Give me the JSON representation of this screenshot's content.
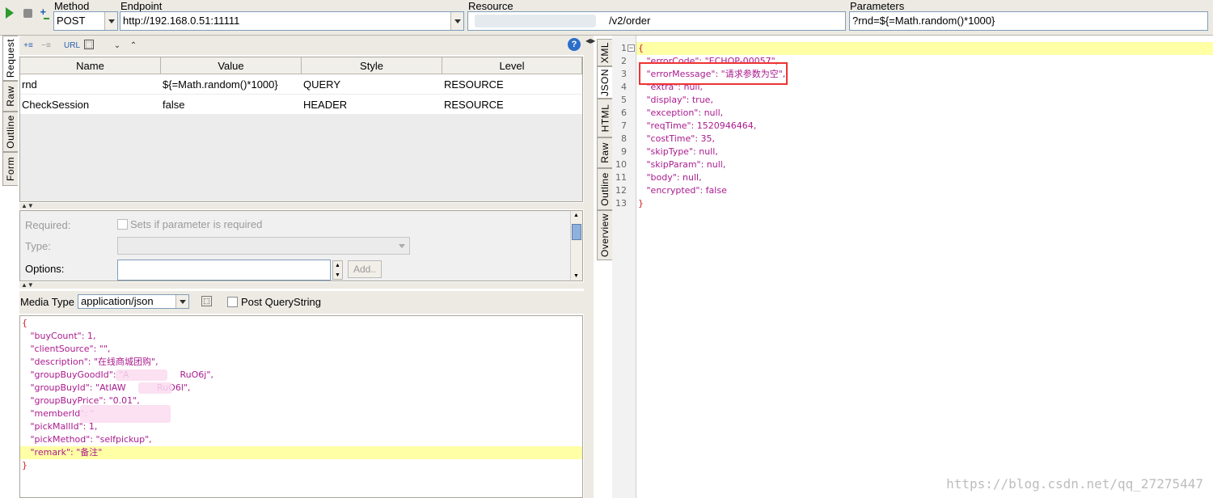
{
  "toolbar": {
    "method_label": "Method",
    "method_value": "POST",
    "endpoint_label": "Endpoint",
    "endpoint_value": "http://192.168.0.51:11111",
    "resource_label": "Resource",
    "resource_value": "/v2/order",
    "parameters_label": "Parameters",
    "parameters_value": "?rnd=${=Math.random()*1000}"
  },
  "left_tabs": [
    "Request",
    "Raw",
    "Outline",
    "Form"
  ],
  "param_table": {
    "columns": [
      "Name",
      "Value",
      "Style",
      "Level"
    ],
    "rows": [
      [
        "rnd",
        "${=Math.random()*1000}",
        "QUERY",
        "RESOURCE"
      ],
      [
        "CheckSession",
        "false",
        "HEADER",
        "RESOURCE"
      ]
    ]
  },
  "param_detail": {
    "required_label": "Required:",
    "required_text": "Sets if parameter is required",
    "type_label": "Type:",
    "options_label": "Options:",
    "add_label": "Add.."
  },
  "media": {
    "label": "Media Type",
    "value": "application/json",
    "post_qs_label": "Post QueryString"
  },
  "request_body": [
    "{",
    "   \"buyCount\": 1,",
    "   \"clientSource\": \"\",",
    "   \"description\": \"在线商城团购\",",
    "   \"groupBuyGoodId\": \"A                  RuO6j\",",
    "   \"groupBuyId\": \"AtlAW           RuO6l\",",
    "   \"groupBuyPrice\": \"0.01\",",
    "   \"memberId\": \"",
    "   \"pickMallId\": 1,",
    "   \"pickMethod\": \"selfpickup\",",
    "   \"remark\": \"备注\"",
    "}"
  ],
  "right_tabs": [
    "XML",
    "JSON",
    "HTML",
    "Raw",
    "Outline",
    "Overview"
  ],
  "response_lines": [
    "1",
    "2",
    "3",
    "4",
    "5",
    "6",
    "7",
    "8",
    "9",
    "10",
    "11",
    "12",
    "13"
  ],
  "response_body": [
    "{",
    "   \"errorCode\": \"ECHOP-00057\",",
    "   \"errorMessage\": \"请求参数为空\",",
    "   \"extra\": null,",
    "   \"display\": true,",
    "   \"exception\": null,",
    "   \"reqTime\": 1520946464,",
    "   \"costTime\": 35,",
    "   \"skipType\": null,",
    "   \"skipParam\": null,",
    "   \"body\": null,",
    "   \"encrypted\": false",
    "}"
  ],
  "watermark": "https://blog.csdn.net/qq_27275447"
}
